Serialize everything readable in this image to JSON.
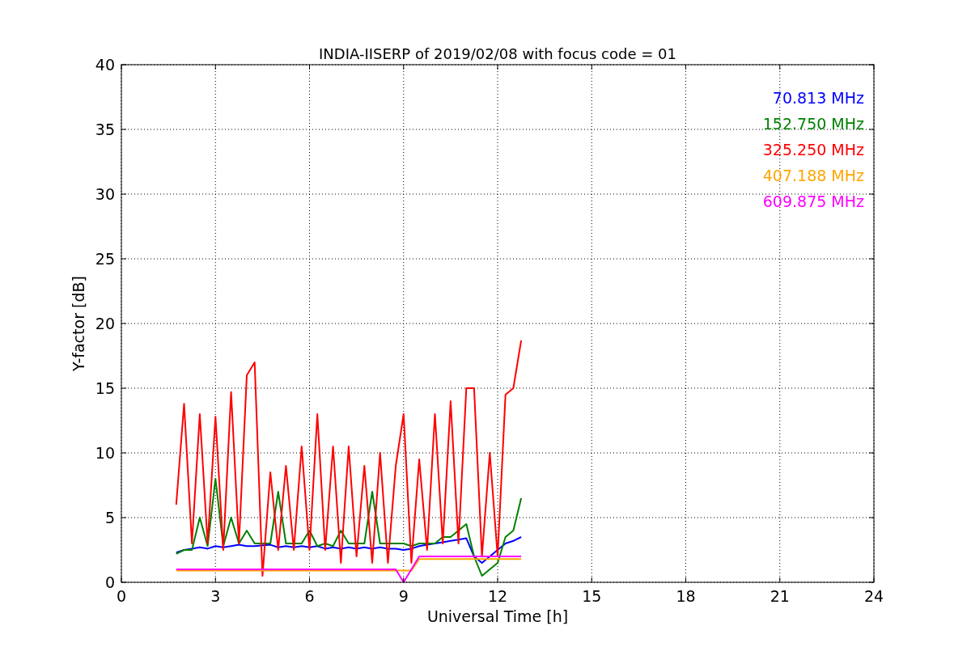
{
  "chart_data": {
    "type": "line",
    "title": "INDIA-IISERP of 2019/02/08 with focus code = 01",
    "xlabel": "Universal Time [h]",
    "ylabel": "Y-factor [dB]",
    "x": [
      1.75,
      2.0,
      2.25,
      2.5,
      2.75,
      3.0,
      3.25,
      3.5,
      3.75,
      4.0,
      4.25,
      4.5,
      4.75,
      5.0,
      5.25,
      5.5,
      5.75,
      6.0,
      6.25,
      6.5,
      6.75,
      7.0,
      7.25,
      7.5,
      7.75,
      8.0,
      8.25,
      8.5,
      8.75,
      9.0,
      9.25,
      9.5,
      9.75,
      10.0,
      10.25,
      10.5,
      10.75,
      11.0,
      11.25,
      11.5,
      11.75,
      12.0,
      12.25,
      12.5,
      12.75
    ],
    "series": [
      {
        "name": "70.813 MHz",
        "color": "#0000ff",
        "values": [
          2.3,
          2.5,
          2.6,
          2.7,
          2.6,
          2.8,
          2.7,
          2.8,
          2.9,
          2.8,
          2.8,
          null,
          2.9,
          2.7,
          2.8,
          2.7,
          2.8,
          2.7,
          2.8,
          2.6,
          2.7,
          2.6,
          2.7,
          2.6,
          2.7,
          2.6,
          2.7,
          2.6,
          2.6,
          2.5,
          2.6,
          2.8,
          2.9,
          3.0,
          3.1,
          3.2,
          3.3,
          3.4,
          2.0,
          1.5,
          2.0,
          2.5,
          3.0,
          3.2,
          3.5
        ]
      },
      {
        "name": "152.750 MHz",
        "color": "#008000",
        "values": [
          2.2,
          2.5,
          2.5,
          5.0,
          2.8,
          8.0,
          2.8,
          5.0,
          3.0,
          4.0,
          3.0,
          null,
          3.0,
          7.0,
          3.0,
          3.0,
          3.0,
          4.0,
          2.8,
          3.0,
          2.8,
          4.0,
          3.0,
          3.0,
          3.0,
          7.0,
          3.0,
          3.0,
          3.0,
          3.0,
          2.8,
          3.0,
          3.0,
          3.0,
          3.5,
          3.5,
          4.0,
          4.5,
          2.0,
          0.5,
          1.0,
          1.5,
          3.5,
          4.0,
          6.5
        ]
      },
      {
        "name": "325.250 MHz",
        "color": "#ff0000",
        "values": [
          6.0,
          13.8,
          3.0,
          13.0,
          3.0,
          12.8,
          2.5,
          14.7,
          3.0,
          16.0,
          17.0,
          0.5,
          8.5,
          2.5,
          9.0,
          2.5,
          10.5,
          2.5,
          13.0,
          2.5,
          10.5,
          1.5,
          10.5,
          2.0,
          9.0,
          1.5,
          10.0,
          1.5,
          9.0,
          13.0,
          1.5,
          9.5,
          2.5,
          13.0,
          3.0,
          14.0,
          3.0,
          15.0,
          15.0,
          2.0,
          10.0,
          2.0,
          14.5,
          15.0,
          18.7
        ]
      },
      {
        "name": "407.188 MHz",
        "color": "#ffa500",
        "values": [
          0.9,
          0.9,
          0.9,
          0.9,
          0.9,
          0.9,
          0.9,
          0.9,
          0.9,
          0.9,
          0.9,
          0.9,
          0.9,
          0.9,
          0.9,
          0.9,
          0.9,
          0.9,
          0.9,
          0.9,
          0.9,
          0.9,
          0.9,
          0.9,
          0.9,
          0.9,
          0.9,
          0.9,
          0.9,
          0.9,
          0.9,
          1.8,
          1.8,
          1.8,
          1.8,
          1.8,
          1.8,
          1.8,
          1.8,
          1.8,
          1.8,
          1.8,
          1.8,
          1.8,
          1.8
        ]
      },
      {
        "name": "609.875 MHz",
        "color": "#ff00ff",
        "values": [
          1.0,
          1.0,
          1.0,
          1.0,
          1.0,
          1.0,
          1.0,
          1.0,
          1.0,
          1.0,
          1.0,
          1.0,
          1.0,
          1.0,
          1.0,
          1.0,
          1.0,
          1.0,
          1.0,
          1.0,
          1.0,
          1.0,
          1.0,
          1.0,
          1.0,
          1.0,
          1.0,
          1.0,
          1.0,
          0.0,
          1.0,
          2.0,
          2.0,
          2.0,
          2.0,
          2.0,
          2.0,
          2.0,
          2.0,
          2.0,
          2.0,
          2.0,
          2.0,
          2.0,
          2.0
        ]
      }
    ],
    "xlim": [
      0,
      24
    ],
    "ylim": [
      0,
      40
    ],
    "xticks": [
      0,
      3,
      6,
      9,
      12,
      15,
      18,
      21,
      24
    ],
    "yticks": [
      0,
      5,
      10,
      15,
      20,
      25,
      30,
      35,
      40
    ],
    "grid": true
  }
}
